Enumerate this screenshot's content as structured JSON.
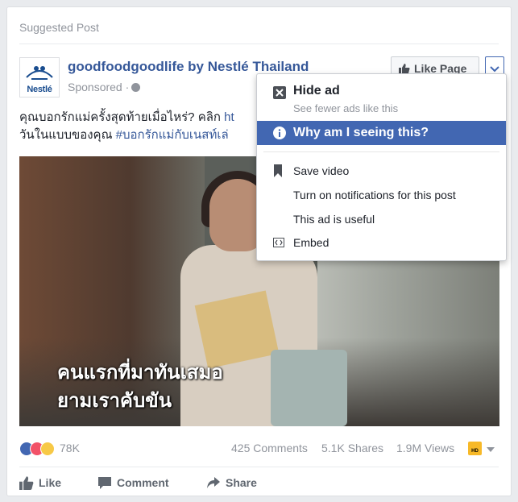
{
  "post": {
    "suggested_label": "Suggested Post",
    "page_name": "goodfoodgoodlife by Nestlé Thailand",
    "sponsored": "Sponsored ·",
    "logo_text": "Nestlé",
    "like_page_label": "Like Page",
    "text_line1_plain": "คุณบอกรักแม่ครั้งสุดท้ายเมื่อไหร่? คลิก ",
    "text_line1_link": "ht",
    "text_line2_plain": "วันในแบบของคุณ ",
    "text_line2_link": "#บอกรักแม่กับเนสท์เล่",
    "video_subtitle_1": "คนแรกที่มาทันเสมอ",
    "video_subtitle_2": "ยามเราคับขัน"
  },
  "stats": {
    "reactions_count": "78K",
    "comments": "425 Comments",
    "shares": "5.1K Shares",
    "views": "1.9M Views",
    "hd_badge": "HD"
  },
  "actions": {
    "like": "Like",
    "comment": "Comment",
    "share": "Share"
  },
  "menu": {
    "hide_ad": "Hide ad",
    "hide_ad_sub": "See fewer ads like this",
    "why": "Why am I seeing this?",
    "save_video": "Save video",
    "notifications": "Turn on notifications for this post",
    "useful": "This ad is useful",
    "embed": "Embed"
  },
  "colors": {
    "fb_blue": "#4267b2",
    "link": "#365899",
    "muted": "#90949c"
  }
}
